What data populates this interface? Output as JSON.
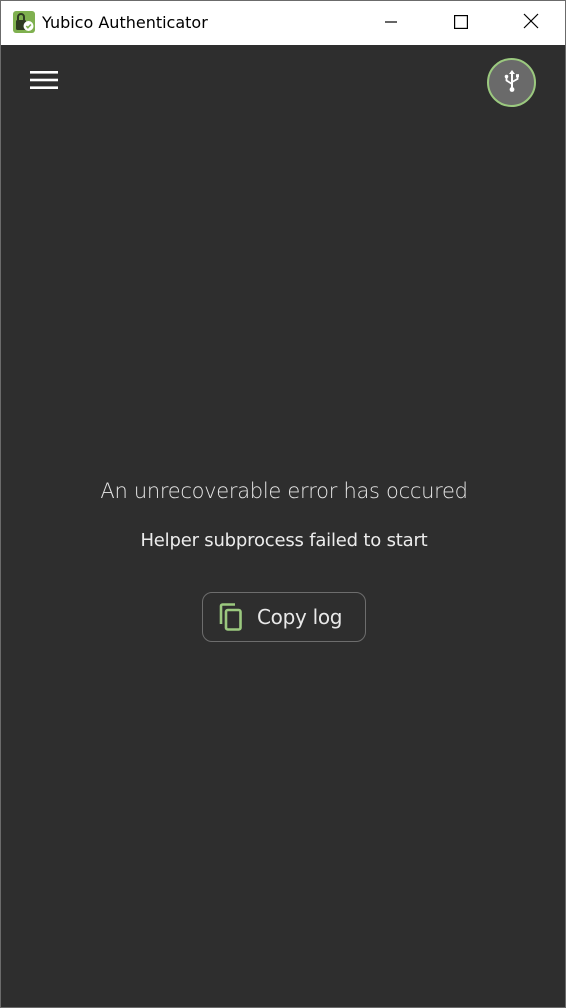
{
  "window": {
    "title": "Yubico Authenticator",
    "controls": {
      "minimize_icon": "minimize-icon",
      "maximize_icon": "maximize-icon",
      "close_icon": "close-icon"
    }
  },
  "appbar": {
    "menu_icon": "hamburger-menu-icon",
    "device_icon": "usb-icon"
  },
  "error": {
    "title": "An unrecoverable error has occured",
    "message": "Helper subprocess failed to start",
    "copy_button_label": "Copy log",
    "copy_icon": "copy-icon"
  },
  "colors": {
    "background": "#2e2e2e",
    "accent": "#9bc97f",
    "titlebar": "#ffffff",
    "text": "#e6e6e6"
  }
}
